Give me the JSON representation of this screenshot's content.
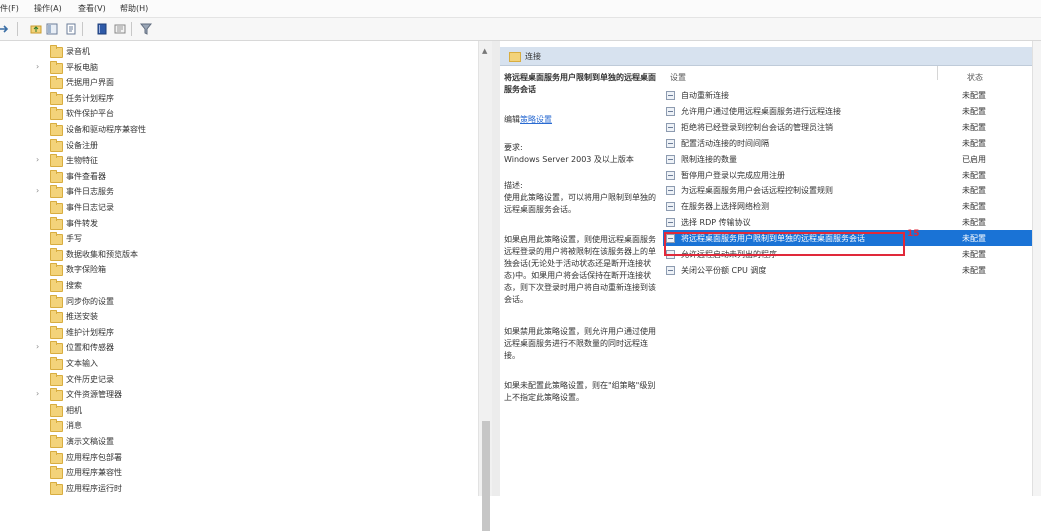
{
  "menu": [
    "件(F)",
    "操作(A)",
    "查看(V)",
    "帮助(H)"
  ],
  "tree": {
    "items": [
      {
        "label": "录音机",
        "expandable": false
      },
      {
        "label": "平板电脑",
        "expandable": true
      },
      {
        "label": "凭据用户界面",
        "expandable": false
      },
      {
        "label": "任务计划程序",
        "expandable": false
      },
      {
        "label": "软件保护平台",
        "expandable": false
      },
      {
        "label": "设备和驱动程序兼容性",
        "expandable": false
      },
      {
        "label": "设备注册",
        "expandable": false
      },
      {
        "label": "生物特征",
        "expandable": true
      },
      {
        "label": "事件查看器",
        "expandable": false
      },
      {
        "label": "事件日志服务",
        "expandable": true
      },
      {
        "label": "事件日志记录",
        "expandable": false
      },
      {
        "label": "事件转发",
        "expandable": false
      },
      {
        "label": "手写",
        "expandable": false
      },
      {
        "label": "数据收集和预览版本",
        "expandable": false
      },
      {
        "label": "数字保险箱",
        "expandable": false
      },
      {
        "label": "搜索",
        "expandable": false
      },
      {
        "label": "同步你的设置",
        "expandable": false
      },
      {
        "label": "推送安装",
        "expandable": false
      },
      {
        "label": "维护计划程序",
        "expandable": false
      },
      {
        "label": "位置和传感器",
        "expandable": true
      },
      {
        "label": "文本输入",
        "expandable": false
      },
      {
        "label": "文件历史记录",
        "expandable": false
      },
      {
        "label": "文件资源管理器",
        "expandable": true
      },
      {
        "label": "相机",
        "expandable": false
      },
      {
        "label": "消息",
        "expandable": false
      },
      {
        "label": "演示文稿设置",
        "expandable": false
      },
      {
        "label": "应用程序包部署",
        "expandable": false
      },
      {
        "label": "应用程序兼容性",
        "expandable": false
      },
      {
        "label": "应用程序运行时",
        "expandable": false
      }
    ]
  },
  "right_header": {
    "title": "连接"
  },
  "description": {
    "policy_title": "将远程桌面服务用户限制到单独的远程桌面服务会话",
    "edit_prefix": "编辑",
    "edit_link": "策略设置",
    "requirements_label": "要求:",
    "requirements_value": "Windows Server 2003 及以上版本",
    "desc_label": "描述:",
    "desc_text": "使用此策略设置，可以将用户限制到单独的远程桌面服务会话。",
    "para2": "如果启用此策略设置，则使用远程桌面服务远程登录的用户将被限制在该服务器上的单独会话(无论处于活动状态还是断开连接状态)中。如果用户将会话保持在断开连接状态，则下次登录时用户将自动重新连接到该会话。",
    "para3": "如果禁用此策略设置，则允许用户通过使用远程桌面服务进行不限数量的同时远程连接。",
    "para4": "如果未配置此策略设置，则在\"组策略\"级别上不指定此策略设置。"
  },
  "settings": {
    "col_setting": "设置",
    "col_state": "状态",
    "rows": [
      {
        "name": "自动重新连接",
        "state": "未配置"
      },
      {
        "name": "允许用户通过使用远程桌面服务进行远程连接",
        "state": "未配置"
      },
      {
        "name": "拒绝将已经登录到控制台会话的管理员注销",
        "state": "未配置"
      },
      {
        "name": "配置活动连接的时间间隔",
        "state": "未配置"
      },
      {
        "name": "限制连接的数量",
        "state": "已启用"
      },
      {
        "name": "暂停用户登录以完成应用注册",
        "state": "未配置"
      },
      {
        "name": "为远程桌面服务用户会话远程控制设置规则",
        "state": "未配置"
      },
      {
        "name": "在服务器上选择网络检测",
        "state": "未配置"
      },
      {
        "name": "选择 RDP 传输协议",
        "state": "未配置"
      },
      {
        "name": "将远程桌面服务用户限制到单独的远程桌面服务会话",
        "state": "未配置"
      },
      {
        "name": "允许远程启动未列出的程序",
        "state": "未配置"
      },
      {
        "name": "关闭公平份额 CPU 调度",
        "state": "未配置"
      }
    ],
    "selected_index": 9
  },
  "annotation": {
    "label": "15",
    "color": "#e0293a"
  },
  "colors": {
    "selection": "#1a73d6",
    "header_bg": "#d7e2ef",
    "link": "#2a6bd2"
  }
}
